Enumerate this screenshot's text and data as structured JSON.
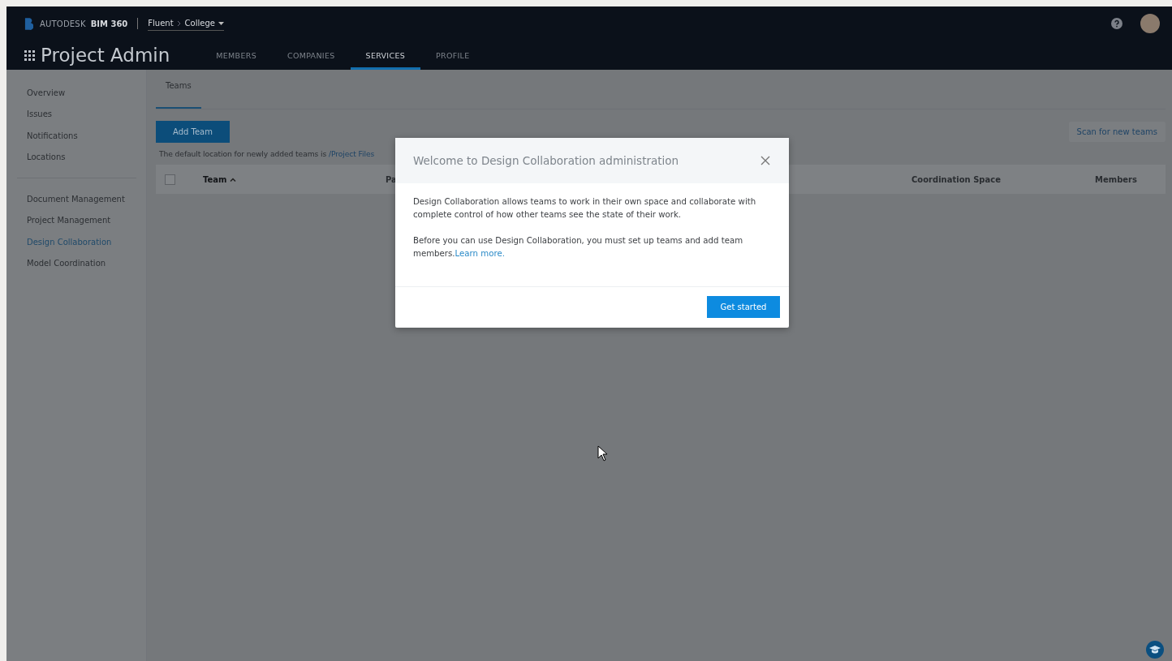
{
  "header": {
    "brand": "AUTODESK",
    "product": "BIM 360",
    "breadcrumb": [
      {
        "label": "Fluent"
      },
      {
        "label": "College"
      }
    ],
    "title": "Project Admin",
    "nav": [
      {
        "label": "MEMBERS",
        "selected": false
      },
      {
        "label": "COMPANIES",
        "selected": false
      },
      {
        "label": "SERVICES",
        "selected": true
      },
      {
        "label": "PROFILE",
        "selected": false
      }
    ]
  },
  "sidebar": {
    "groups": [
      [
        {
          "label": "Overview",
          "selected": false
        },
        {
          "label": "Issues",
          "selected": false
        },
        {
          "label": "Notifications",
          "selected": false
        },
        {
          "label": "Locations",
          "selected": false
        }
      ],
      [
        {
          "label": "Document Management",
          "selected": false
        },
        {
          "label": "Project Management",
          "selected": false
        },
        {
          "label": "Design Collaboration",
          "selected": true
        },
        {
          "label": "Model Coordination",
          "selected": false
        }
      ]
    ]
  },
  "tabs": [
    {
      "label": "Teams",
      "selected": true
    }
  ],
  "add_button": "Add Team",
  "scan_button": "Scan for new teams",
  "note": {
    "text": "The default location for newly added teams is",
    "path": "/Project Files"
  },
  "table": {
    "select_all_checked": false,
    "columns": [
      {
        "label": "Team",
        "sorted": true
      },
      {
        "label": "Pa",
        "sorted": false
      },
      {
        "label": "Coordination Space",
        "sorted": false
      },
      {
        "label": "Members",
        "sorted": false
      }
    ]
  },
  "modal": {
    "title": "Welcome to Design Collaboration administration",
    "paragraphs": [
      {
        "text": "Design Collaboration allows teams to work in their own space and collaborate with complete control of how other teams see the state of their work."
      },
      {
        "text": "Before you can use Design Collaboration, you must set up teams and add team members.",
        "link": "Learn more."
      }
    ],
    "button": "Get started"
  }
}
